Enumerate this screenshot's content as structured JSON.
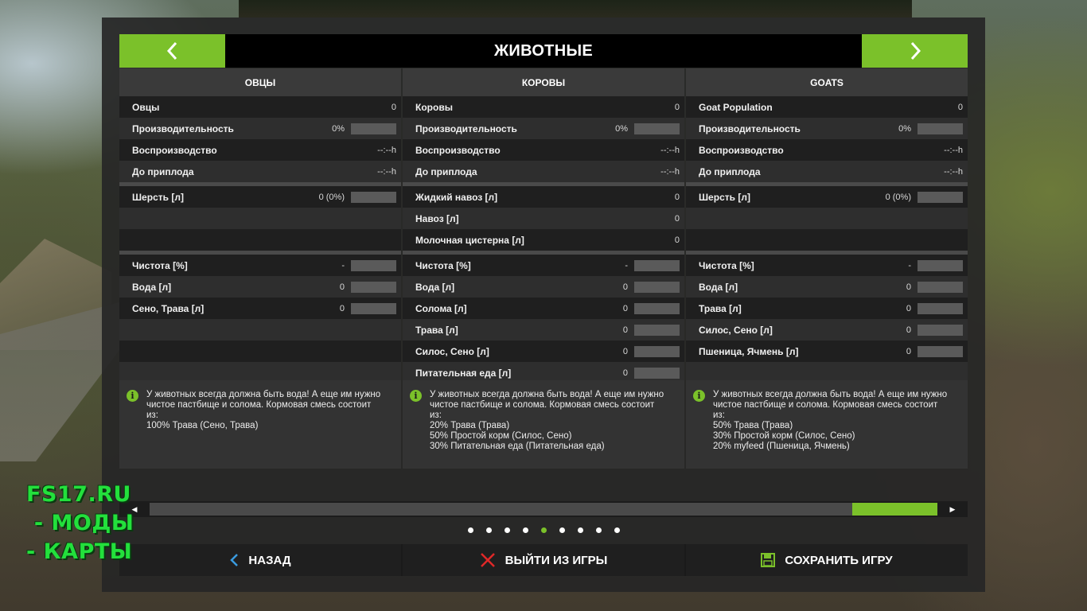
{
  "header": {
    "title": "ЖИВОТНЫЕ",
    "prev_icon": "chevron-left-icon",
    "next_icon": "chevron-right-icon"
  },
  "columns": [
    {
      "title": "ОВЦЫ",
      "stats": [
        {
          "label": "Овцы",
          "value": "0",
          "bar": false
        },
        {
          "label": "Производительность",
          "value": "0%",
          "bar": true,
          "level": 0
        },
        {
          "label": "Воспроизводство",
          "value": "--:--h",
          "bar": false
        },
        {
          "label": "До приплода",
          "value": "--:--h",
          "bar": false
        }
      ],
      "products": [
        {
          "label": "Шерсть [л]",
          "value": "0 (0%)",
          "bar": true,
          "level": 0
        },
        {
          "label": "",
          "value": "",
          "bar": false
        },
        {
          "label": "",
          "value": "",
          "bar": false
        }
      ],
      "needs": [
        {
          "label": "Чистота [%]",
          "value": "-",
          "bar": true,
          "level": 0
        },
        {
          "label": "Вода [л]",
          "value": "0",
          "bar": true,
          "level": 0
        },
        {
          "label": "Сено, Трава [л]",
          "value": "0",
          "bar": true,
          "level": 0
        },
        {
          "label": "",
          "value": "",
          "bar": false
        },
        {
          "label": "",
          "value": "",
          "bar": false
        },
        {
          "label": "",
          "value": "",
          "bar": false
        }
      ],
      "info": "У животных всегда должна быть вода! А еще им нужно\nчистое пастбище и солома. Кормовая смесь состоит\nиз:\n100% Трава (Сено, Трава)"
    },
    {
      "title": "КОРОВЫ",
      "stats": [
        {
          "label": "Коровы",
          "value": "0",
          "bar": false
        },
        {
          "label": "Производительность",
          "value": "0%",
          "bar": true,
          "level": 0
        },
        {
          "label": "Воспроизводство",
          "value": "--:--h",
          "bar": false
        },
        {
          "label": "До приплода",
          "value": "--:--h",
          "bar": false
        }
      ],
      "products": [
        {
          "label": "Жидкий навоз [л]",
          "value": "0",
          "bar": false
        },
        {
          "label": "Навоз [л]",
          "value": "0",
          "bar": false
        },
        {
          "label": "Молочная цистерна [л]",
          "value": "0",
          "bar": false
        }
      ],
      "needs": [
        {
          "label": "Чистота [%]",
          "value": "-",
          "bar": true,
          "level": 0
        },
        {
          "label": "Вода [л]",
          "value": "0",
          "bar": true,
          "level": 0
        },
        {
          "label": "Солома [л]",
          "value": "0",
          "bar": true,
          "level": 0
        },
        {
          "label": "Трава [л]",
          "value": "0",
          "bar": true,
          "level": 0
        },
        {
          "label": "Силос, Сено [л]",
          "value": "0",
          "bar": true,
          "level": 0
        },
        {
          "label": "Питательная еда [л]",
          "value": "0",
          "bar": true,
          "level": 0
        }
      ],
      "info": "У животных всегда должна быть вода! А еще им нужно\nчистое пастбище и солома. Кормовая смесь состоит\nиз:\n20% Трава (Трава)\n50% Простой корм (Силос, Сено)\n30% Питательная еда (Питательная еда)"
    },
    {
      "title": "GOATS",
      "stats": [
        {
          "label": "Goat Population",
          "value": "0",
          "bar": false
        },
        {
          "label": "Производительность",
          "value": "0%",
          "bar": true,
          "level": 0
        },
        {
          "label": "Воспроизводство",
          "value": "--:--h",
          "bar": false
        },
        {
          "label": "До приплода",
          "value": "--:--h",
          "bar": false
        }
      ],
      "products": [
        {
          "label": "Шерсть [л]",
          "value": "0 (0%)",
          "bar": true,
          "level": 0
        },
        {
          "label": "",
          "value": "",
          "bar": false
        },
        {
          "label": "",
          "value": "",
          "bar": false
        }
      ],
      "needs": [
        {
          "label": "Чистота [%]",
          "value": "-",
          "bar": true,
          "level": 0
        },
        {
          "label": "Вода [л]",
          "value": "0",
          "bar": true,
          "level": 0
        },
        {
          "label": "Трава [л]",
          "value": "0",
          "bar": true,
          "level": 0
        },
        {
          "label": "Силос, Сено [л]",
          "value": "0",
          "bar": true,
          "level": 0
        },
        {
          "label": "Пшеница, Ячмень [л]",
          "value": "0",
          "bar": true,
          "level": 0
        },
        {
          "label": "",
          "value": "",
          "bar": false
        }
      ],
      "info": "У животных всегда должна быть вода! А еще им нужно\nчистое пастбище и солома. Кормовая смесь состоит\nиз:\n50% Трава (Трава)\n30% Простой корм (Силос, Сено)\n20% myfeed (Пшеница, Ячмень)"
    }
  ],
  "scrollbar": {
    "position": 1.0
  },
  "pagination": {
    "count": 9,
    "active_index": 4
  },
  "bottom_buttons": [
    {
      "label": "НАЗАД",
      "icon": "back-arrow-icon",
      "color": "#3a9be0"
    },
    {
      "label": "ВЫЙТИ ИЗ ИГРЫ",
      "icon": "close-icon",
      "color": "#e02828"
    },
    {
      "label": "СОХРАНИТЬ ИГРУ",
      "icon": "save-icon",
      "color": "#7bc12a"
    }
  ],
  "watermark": {
    "lines": [
      "FS17.RU",
      " - МОДЫ",
      "- КАРТЫ"
    ],
    "color": "#23e03c"
  },
  "colors": {
    "accent": "#7bc12a",
    "header_bg": "#000000",
    "panel_bg": "#262626"
  }
}
